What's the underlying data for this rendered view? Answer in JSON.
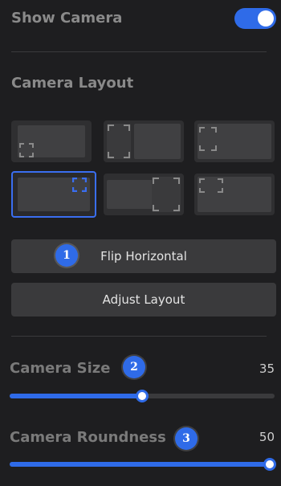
{
  "show_camera": {
    "label": "Show Camera",
    "enabled": true
  },
  "camera_layout": {
    "title": "Camera Layout",
    "selected_index": 3,
    "options_count": 6
  },
  "buttons": {
    "flip_horizontal": "Flip Horizontal",
    "adjust_layout": "Adjust Layout"
  },
  "badges": {
    "one": "1",
    "two": "2",
    "three": "3"
  },
  "camera_size": {
    "label": "Camera Size",
    "value": "35",
    "fraction": 0.5
  },
  "camera_roundness": {
    "label": "Camera Roundness",
    "value": "50",
    "fraction": 1.0
  },
  "colors": {
    "accent": "#2f6be8",
    "background": "#1e1e20",
    "panel": "#3a3a3c"
  }
}
